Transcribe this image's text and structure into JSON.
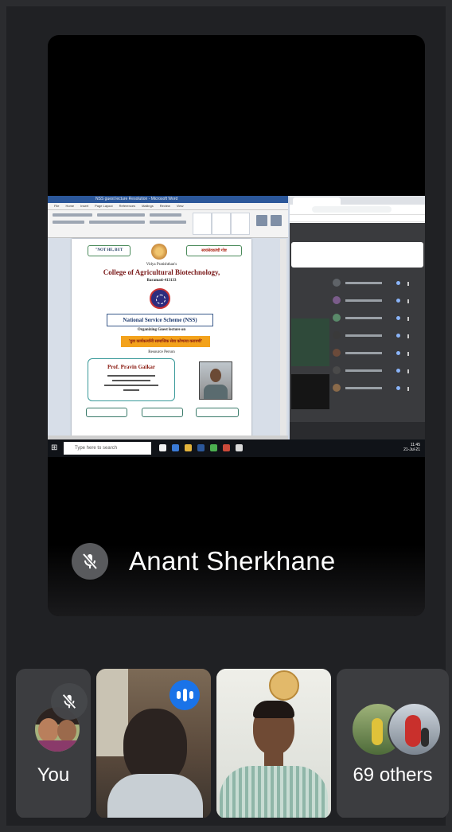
{
  "presenter": {
    "name": "Anant Sherkhane",
    "mic_status": "muted"
  },
  "shared_screen": {
    "word_window_title": "NSS guest lecture Resolution - Microsoft Word",
    "document": {
      "badge_left": "\"NOT HE, BUT",
      "badge_right": "स्वयंसेवकांची गोष्ट",
      "line1": "Vidya Pratishthan's",
      "college": "College of Agricultural Biotechnology,",
      "city": "Baramati-413133",
      "scheme": "National Service Scheme (NSS)",
      "organizing": "Organizing Guest lecture on",
      "topic_marathi": "'युवा कार्यकर्त्यांनी सामाजिक सेवा कोणत्या करायची'",
      "resource_person": "Resource Person",
      "speaker": "Prof. Pravin Gaikar"
    },
    "taskbar_search_placeholder": "Type here to search",
    "clock_time": "11:45",
    "clock_date": "21-Jul-21"
  },
  "tiles": {
    "you_label": "You",
    "others_label": "69 others"
  },
  "icons": {
    "mic_off": "mic-off-icon",
    "speaking": "audio-level-icon",
    "windows": "windows-icon",
    "search": "search-icon"
  },
  "colors": {
    "background": "#202124",
    "speaking_indicator": "#1a73e8",
    "muted_circle": "#595a5d"
  }
}
